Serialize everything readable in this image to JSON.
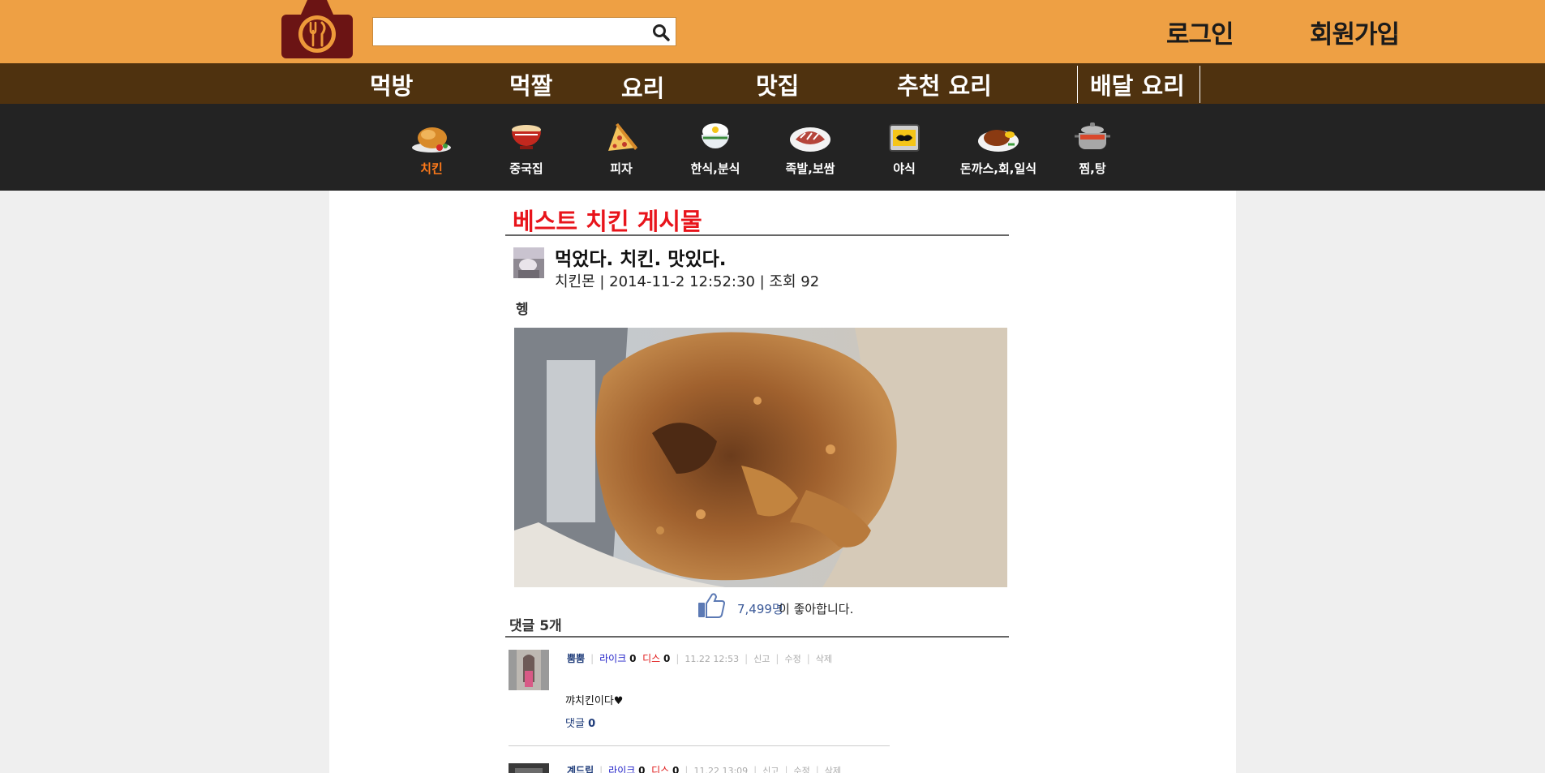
{
  "header": {
    "search": {
      "placeholder": "",
      "value": ""
    },
    "login_label": "로그인",
    "signup_label": "회원가입",
    "brand_color": "#eea044"
  },
  "main_nav": {
    "items": [
      {
        "label": "먹방"
      },
      {
        "label": "먹짤"
      },
      {
        "label": "요리"
      },
      {
        "label": "맛집"
      },
      {
        "label": "추천 요리"
      },
      {
        "label": "배달 요리"
      }
    ]
  },
  "categories": {
    "active_color": "#ff7a1a",
    "items": [
      {
        "label": "치킨",
        "icon": "roast-chicken-icon"
      },
      {
        "label": "중국집",
        "icon": "noodle-bowl-icon"
      },
      {
        "label": "피자",
        "icon": "pizza-slice-icon"
      },
      {
        "label": "한식,분식",
        "icon": "rice-bowl-icon"
      },
      {
        "label": "족발,보쌈",
        "icon": "pork-platter-icon"
      },
      {
        "label": "야식",
        "icon": "night-snack-icon"
      },
      {
        "label": "돈까스,회,일식",
        "icon": "cutlet-plate-icon"
      },
      {
        "label": "찜,탕",
        "icon": "stew-pot-icon"
      }
    ]
  },
  "board": {
    "title": "베스트 치킨 게시물",
    "title_color": "#e8141b"
  },
  "post": {
    "title": "먹었다. 치킨. 맛있다.",
    "meta": "치킨몬 | 2014-11-2 12:52:30 | 조회 92",
    "body": "헹",
    "likes_count": "7,499명",
    "likes_suffix": "이 좋아합니다."
  },
  "comments": {
    "count_label": "댓글 5개",
    "items": [
      {
        "nickname": "뿜뿜",
        "like_label": "라이크",
        "like_count": "0",
        "dis_label": "디스",
        "dis_count": "0",
        "time": "11.22 12:53",
        "report": "신고",
        "edit": "수정",
        "delete": "삭제",
        "text": "꺄치킨이다♥",
        "reply_label": "댓글",
        "reply_count": "0"
      },
      {
        "nickname": "계드립",
        "like_label": "라이크",
        "like_count": "0",
        "dis_label": "디스",
        "dis_count": "0",
        "time": "11.22 13:09",
        "report": "신고",
        "edit": "수정",
        "delete": "삭제",
        "text": "",
        "reply_label": "",
        "reply_count": ""
      }
    ]
  }
}
